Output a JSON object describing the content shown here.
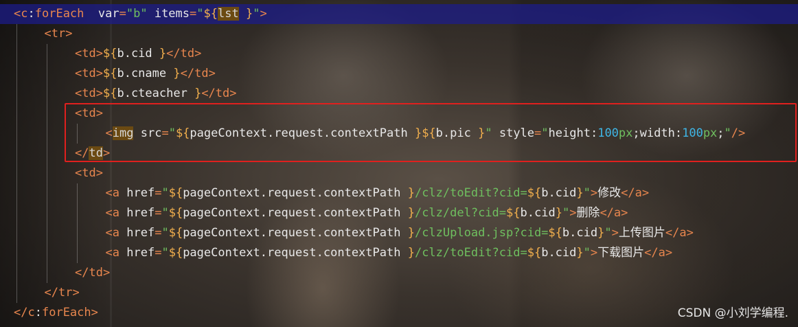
{
  "code_lines": [
    {
      "indent": 0,
      "tokens": [
        [
          "brk",
          "<"
        ],
        [
          "ns",
          "c"
        ],
        [
          "sym",
          ":"
        ],
        [
          "tg",
          "forEach"
        ],
        [
          "sym",
          "  "
        ],
        [
          "attr",
          "var"
        ],
        [
          "eq",
          "="
        ],
        [
          "str",
          "\"b\""
        ],
        [
          "sym",
          " "
        ],
        [
          "attr",
          "items"
        ],
        [
          "eq",
          "="
        ],
        [
          "str",
          "\""
        ],
        [
          "dollar",
          "${"
        ],
        [
          "match",
          "lst"
        ],
        [
          "sym",
          " "
        ],
        [
          "dollar",
          "}"
        ],
        [
          "str",
          "\""
        ],
        [
          "brk",
          ">"
        ]
      ],
      "highlight": true
    },
    {
      "indent": 1,
      "tokens": [
        [
          "brk",
          "<"
        ],
        [
          "tg",
          "tr"
        ],
        [
          "brk",
          ">"
        ]
      ]
    },
    {
      "indent": 2,
      "tokens": [
        [
          "brk",
          "<"
        ],
        [
          "tg",
          "td"
        ],
        [
          "brk",
          ">"
        ],
        [
          "dollar",
          "${"
        ],
        [
          "el",
          "b.cid "
        ],
        [
          "dollar",
          "}"
        ],
        [
          "brk",
          "</"
        ],
        [
          "tg",
          "td"
        ],
        [
          "brk",
          ">"
        ]
      ]
    },
    {
      "indent": 2,
      "tokens": [
        [
          "brk",
          "<"
        ],
        [
          "tg",
          "td"
        ],
        [
          "brk",
          ">"
        ],
        [
          "dollar",
          "${"
        ],
        [
          "el",
          "b.cname "
        ],
        [
          "dollar",
          "}"
        ],
        [
          "brk",
          "</"
        ],
        [
          "tg",
          "td"
        ],
        [
          "brk",
          ">"
        ]
      ]
    },
    {
      "indent": 2,
      "tokens": [
        [
          "brk",
          "<"
        ],
        [
          "tg",
          "td"
        ],
        [
          "brk",
          ">"
        ],
        [
          "dollar",
          "${"
        ],
        [
          "el",
          "b.cteacher "
        ],
        [
          "dollar",
          "}"
        ],
        [
          "brk",
          "</"
        ],
        [
          "tg",
          "td"
        ],
        [
          "brk",
          ">"
        ]
      ]
    },
    {
      "indent": 2,
      "tokens": [
        [
          "brk",
          "<"
        ],
        [
          "tg",
          "td"
        ],
        [
          "brk",
          ">"
        ]
      ]
    },
    {
      "indent": 3,
      "tokens": [
        [
          "brk",
          "<"
        ],
        [
          "match",
          "img"
        ],
        [
          "sym",
          " "
        ],
        [
          "attr",
          "src"
        ],
        [
          "eq",
          "="
        ],
        [
          "str",
          "\""
        ],
        [
          "dollar",
          "${"
        ],
        [
          "el",
          "pageContext.request.contextPath "
        ],
        [
          "dollar",
          "}"
        ],
        [
          "dollar",
          "${"
        ],
        [
          "el",
          "b.pic "
        ],
        [
          "dollar",
          "}"
        ],
        [
          "str",
          "\""
        ],
        [
          "sym",
          " "
        ],
        [
          "attr",
          "style"
        ],
        [
          "eq",
          "="
        ],
        [
          "str",
          "\""
        ],
        [
          "el",
          "height"
        ],
        [
          "sym",
          ":"
        ],
        [
          "num",
          "100"
        ],
        [
          "str",
          "px"
        ],
        [
          "sym",
          ";"
        ],
        [
          "el",
          "width"
        ],
        [
          "sym",
          ":"
        ],
        [
          "num",
          "100"
        ],
        [
          "str",
          "px"
        ],
        [
          "sym",
          ";"
        ],
        [
          "str",
          "\""
        ],
        [
          "brk",
          "/>"
        ]
      ]
    },
    {
      "indent": 2,
      "tokens": [
        [
          "brk",
          "</"
        ],
        [
          "match",
          "td"
        ],
        [
          "brk",
          ">"
        ]
      ]
    },
    {
      "indent": 2,
      "tokens": [
        [
          "brk",
          "<"
        ],
        [
          "tg",
          "td"
        ],
        [
          "brk",
          ">"
        ]
      ]
    },
    {
      "indent": 3,
      "tokens": [
        [
          "brk",
          "<"
        ],
        [
          "tg",
          "a"
        ],
        [
          "sym",
          " "
        ],
        [
          "attr",
          "href"
        ],
        [
          "eq",
          "="
        ],
        [
          "str",
          "\""
        ],
        [
          "dollar",
          "${"
        ],
        [
          "el",
          "pageContext.request.contextPath "
        ],
        [
          "dollar",
          "}"
        ],
        [
          "str",
          "/clz/toEdit?cid="
        ],
        [
          "dollar",
          "${"
        ],
        [
          "el",
          "b.cid"
        ],
        [
          "dollar",
          "}"
        ],
        [
          "str",
          "\""
        ],
        [
          "brk",
          ">"
        ],
        [
          "cn",
          "修改"
        ],
        [
          "brk",
          "</"
        ],
        [
          "tg",
          "a"
        ],
        [
          "brk",
          ">"
        ]
      ]
    },
    {
      "indent": 3,
      "tokens": [
        [
          "brk",
          "<"
        ],
        [
          "tg",
          "a"
        ],
        [
          "sym",
          " "
        ],
        [
          "attr",
          "href"
        ],
        [
          "eq",
          "="
        ],
        [
          "str",
          "\""
        ],
        [
          "dollar",
          "${"
        ],
        [
          "el",
          "pageContext.request.contextPath "
        ],
        [
          "dollar",
          "}"
        ],
        [
          "str",
          "/clz/del?cid="
        ],
        [
          "dollar",
          "${"
        ],
        [
          "el",
          "b.cid"
        ],
        [
          "dollar",
          "}"
        ],
        [
          "str",
          "\""
        ],
        [
          "brk",
          ">"
        ],
        [
          "cn",
          "删除"
        ],
        [
          "brk",
          "</"
        ],
        [
          "tg",
          "a"
        ],
        [
          "brk",
          ">"
        ]
      ]
    },
    {
      "indent": 3,
      "tokens": [
        [
          "brk",
          "<"
        ],
        [
          "tg",
          "a"
        ],
        [
          "sym",
          " "
        ],
        [
          "attr",
          "href"
        ],
        [
          "eq",
          "="
        ],
        [
          "str",
          "\""
        ],
        [
          "dollar",
          "${"
        ],
        [
          "el",
          "pageContext.request.contextPath "
        ],
        [
          "dollar",
          "}"
        ],
        [
          "str",
          "/clzUpload.jsp?cid="
        ],
        [
          "dollar",
          "${"
        ],
        [
          "el",
          "b.cid"
        ],
        [
          "dollar",
          "}"
        ],
        [
          "str",
          "\""
        ],
        [
          "brk",
          ">"
        ],
        [
          "cn",
          "上传图片"
        ],
        [
          "brk",
          "</"
        ],
        [
          "tg",
          "a"
        ],
        [
          "brk",
          ">"
        ]
      ]
    },
    {
      "indent": 3,
      "tokens": [
        [
          "brk",
          "<"
        ],
        [
          "tg",
          "a"
        ],
        [
          "sym",
          " "
        ],
        [
          "attr",
          "href"
        ],
        [
          "eq",
          "="
        ],
        [
          "str",
          "\""
        ],
        [
          "dollar",
          "${"
        ],
        [
          "el",
          "pageContext.request.contextPath "
        ],
        [
          "dollar",
          "}"
        ],
        [
          "str",
          "/clz/toEdit?cid="
        ],
        [
          "dollar",
          "${"
        ],
        [
          "el",
          "b.cid"
        ],
        [
          "dollar",
          "}"
        ],
        [
          "str",
          "\""
        ],
        [
          "brk",
          ">"
        ],
        [
          "cn",
          "下载图片"
        ],
        [
          "brk",
          "</"
        ],
        [
          "tg",
          "a"
        ],
        [
          "brk",
          ">"
        ]
      ]
    },
    {
      "indent": 2,
      "tokens": [
        [
          "brk",
          "</"
        ],
        [
          "tg",
          "td"
        ],
        [
          "brk",
          ">"
        ]
      ]
    },
    {
      "indent": 1,
      "tokens": [
        [
          "brk",
          "</"
        ],
        [
          "tg",
          "tr"
        ],
        [
          "brk",
          ">"
        ]
      ]
    },
    {
      "indent": 0,
      "tokens": [
        [
          "brk",
          "</"
        ],
        [
          "ns",
          "c"
        ],
        [
          "sym",
          ":"
        ],
        [
          "tg",
          "forEach"
        ],
        [
          "brk",
          ">"
        ]
      ]
    }
  ],
  "watermark": "CSDN @小刘学编程."
}
